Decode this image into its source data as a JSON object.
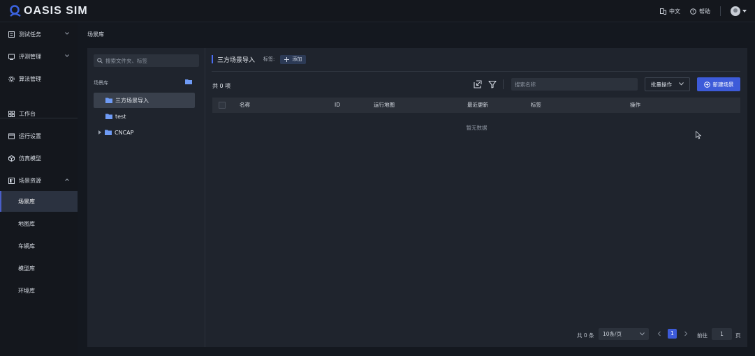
{
  "app": {
    "logo_text": "OASIS SIM",
    "accent": "#3d5bd9"
  },
  "topbar": {
    "language_label": "中文",
    "help_label": "帮助"
  },
  "sidebar": {
    "items": [
      {
        "label": "测试任务",
        "icon": "task-icon"
      },
      {
        "label": "评测管理",
        "icon": "evaluation-icon"
      },
      {
        "label": "算法管理",
        "icon": "gear-icon"
      },
      {
        "label": "工作台",
        "icon": "workbench-icon"
      },
      {
        "label": "运行设置",
        "icon": "run-settings-icon"
      },
      {
        "label": "仿真模型",
        "icon": "cube-icon"
      },
      {
        "label": "场景资源",
        "icon": "resources-icon"
      }
    ],
    "subitems": [
      {
        "label": "场景库",
        "active": true
      },
      {
        "label": "地图库",
        "active": false
      },
      {
        "label": "车辆库",
        "active": false
      },
      {
        "label": "模型库",
        "active": false
      },
      {
        "label": "环境库",
        "active": false
      }
    ]
  },
  "breadcrumb": "场景库",
  "tree": {
    "search_placeholder": "搜索文件夹、标签",
    "header": "场景库",
    "nodes": [
      {
        "label": "三方场景导入",
        "selected": true
      },
      {
        "label": "test",
        "selected": false
      },
      {
        "label": "CNCAP",
        "selected": false
      }
    ]
  },
  "main": {
    "title": "三方场景导入",
    "tag_label": "标签:",
    "tag_add_label": "添加",
    "count_label": "共 0 项",
    "search_placeholder": "搜索名称",
    "batch_label": "批量操作",
    "new_label": "新建场景",
    "columns": [
      "名称",
      "ID",
      "运行地图",
      "最近更新",
      "标签",
      "操作"
    ],
    "empty_text": "暂无数据"
  },
  "pagination": {
    "total_label": "共 0 条",
    "page_size": "10条/页",
    "current_page": "1",
    "goto_label": "前往",
    "goto_value": "1",
    "page_suffix": "页"
  }
}
